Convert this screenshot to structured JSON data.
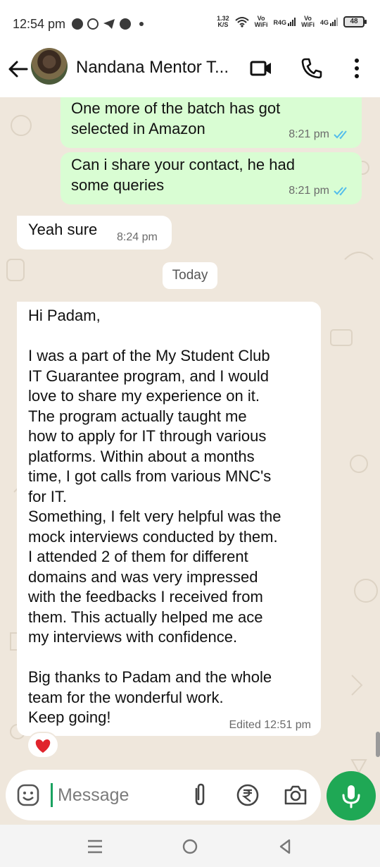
{
  "status_bar": {
    "time": "12:54 pm",
    "net_speed": "1.32",
    "net_unit": "K/S",
    "sim1_label": "Vo",
    "sim1_sub": "WiFi",
    "sim1_net": "R4G",
    "sim2_label": "Vo",
    "sim2_sub": "WiFi",
    "sim2_net": "4G",
    "battery": "48",
    "notification_icons": [
      "messages-icon",
      "b-app-icon",
      "telegram-icon",
      "chat-icon"
    ]
  },
  "header": {
    "title": "Nandana Mentor T...",
    "icons": [
      "back-arrow-icon",
      "video-call-icon",
      "phone-call-icon",
      "more-vertical-icon"
    ]
  },
  "messages": [
    {
      "direction": "outgoing",
      "text": "One more of the batch has got\nselected in Amazon",
      "time": "8:21 pm",
      "status": "read"
    },
    {
      "direction": "outgoing",
      "text": "Can i share your contact, he had\nsome queries",
      "time": "8:21 pm",
      "status": "read"
    },
    {
      "direction": "incoming",
      "text": "Yeah sure",
      "time": "8:24 pm"
    },
    {
      "direction": "incoming",
      "text": "Hi Padam,\n\nI was a part of the My Student Club\nIT Guarantee program, and I would\nlove to share my experience on it.\nThe program actually taught me\nhow to apply for IT through various\nplatforms. Within about a months\ntime, I got calls from various MNC's\nfor IT.\nSomething, I felt very helpful was the\nmock interviews conducted by them.\nI attended 2 of them for different\ndomains and was very impressed\nwith the feedbacks I received from\nthem. This actually helped me ace\nmy interviews with confidence.\n\nBig thanks to Padam and the whole\nteam for the wonderful work.\nKeep going!",
      "time": "Edited 12:51 pm",
      "reaction": "heart-emoji"
    }
  ],
  "date_separator": "Today",
  "colors": {
    "outgoing_bubble": "#d9fdd3",
    "incoming_bubble": "#ffffff",
    "chat_background": "#efe7dc",
    "read_ticks": "#53bdeb",
    "accent": "#1fa855",
    "reaction": "#e0242c"
  },
  "composer": {
    "placeholder": "Message",
    "icons": [
      "emoji-icon",
      "attach-icon",
      "rupee-payment-icon",
      "camera-icon",
      "mic-icon"
    ]
  },
  "nav_bar": {
    "icons": [
      "recents-icon",
      "home-icon",
      "back-icon"
    ]
  }
}
